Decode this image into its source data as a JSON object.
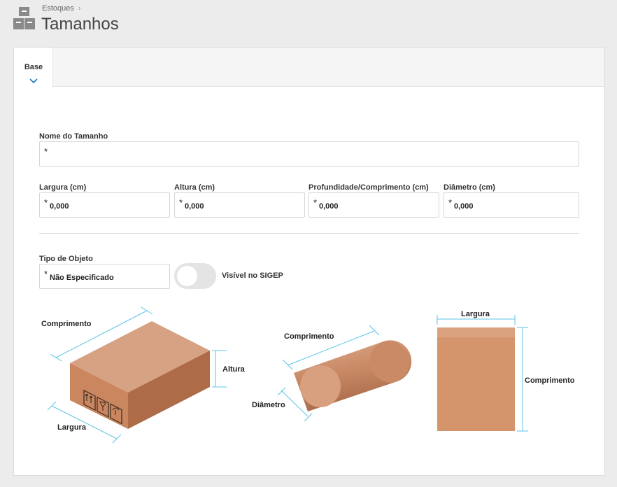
{
  "breadcrumb": {
    "parent": "Estoques"
  },
  "page": {
    "title": "Tamanhos"
  },
  "tabs": [
    {
      "label": "Base"
    }
  ],
  "form": {
    "name": {
      "label": "Nome do Tamanho",
      "required_mark": "*",
      "value": ""
    },
    "width": {
      "label": "Largura (cm)",
      "required_mark": "*",
      "value": "0,000"
    },
    "height": {
      "label": "Altura (cm)",
      "required_mark": "*",
      "value": "0,000"
    },
    "depth": {
      "label": "Profundidade/Comprimento (cm)",
      "required_mark": "*",
      "value": "0,000"
    },
    "diameter": {
      "label": "Diâmetro (cm)",
      "required_mark": "*",
      "value": "0,000"
    },
    "object_type": {
      "label": "Tipo de Objeto",
      "required_mark": "*",
      "value": "Não Especificado"
    },
    "sigep_toggle": {
      "label": "Visível no SIGEP",
      "on": false
    }
  },
  "illustrations": {
    "box": {
      "length_label": "Comprimento",
      "height_label": "Altura",
      "width_label": "Largura"
    },
    "cylinder": {
      "length_label": "Comprimento",
      "diameter_label": "Diâmetro"
    },
    "envelope": {
      "width_label": "Largura",
      "length_label": "Comprimento"
    }
  },
  "colors": {
    "accent": "#1a7ec8",
    "dimension_line": "#5bc4e6",
    "box_front": "#c9865f",
    "box_top": "#d6a283",
    "box_side": "#ad6b48",
    "envelope": "#d4956d"
  }
}
